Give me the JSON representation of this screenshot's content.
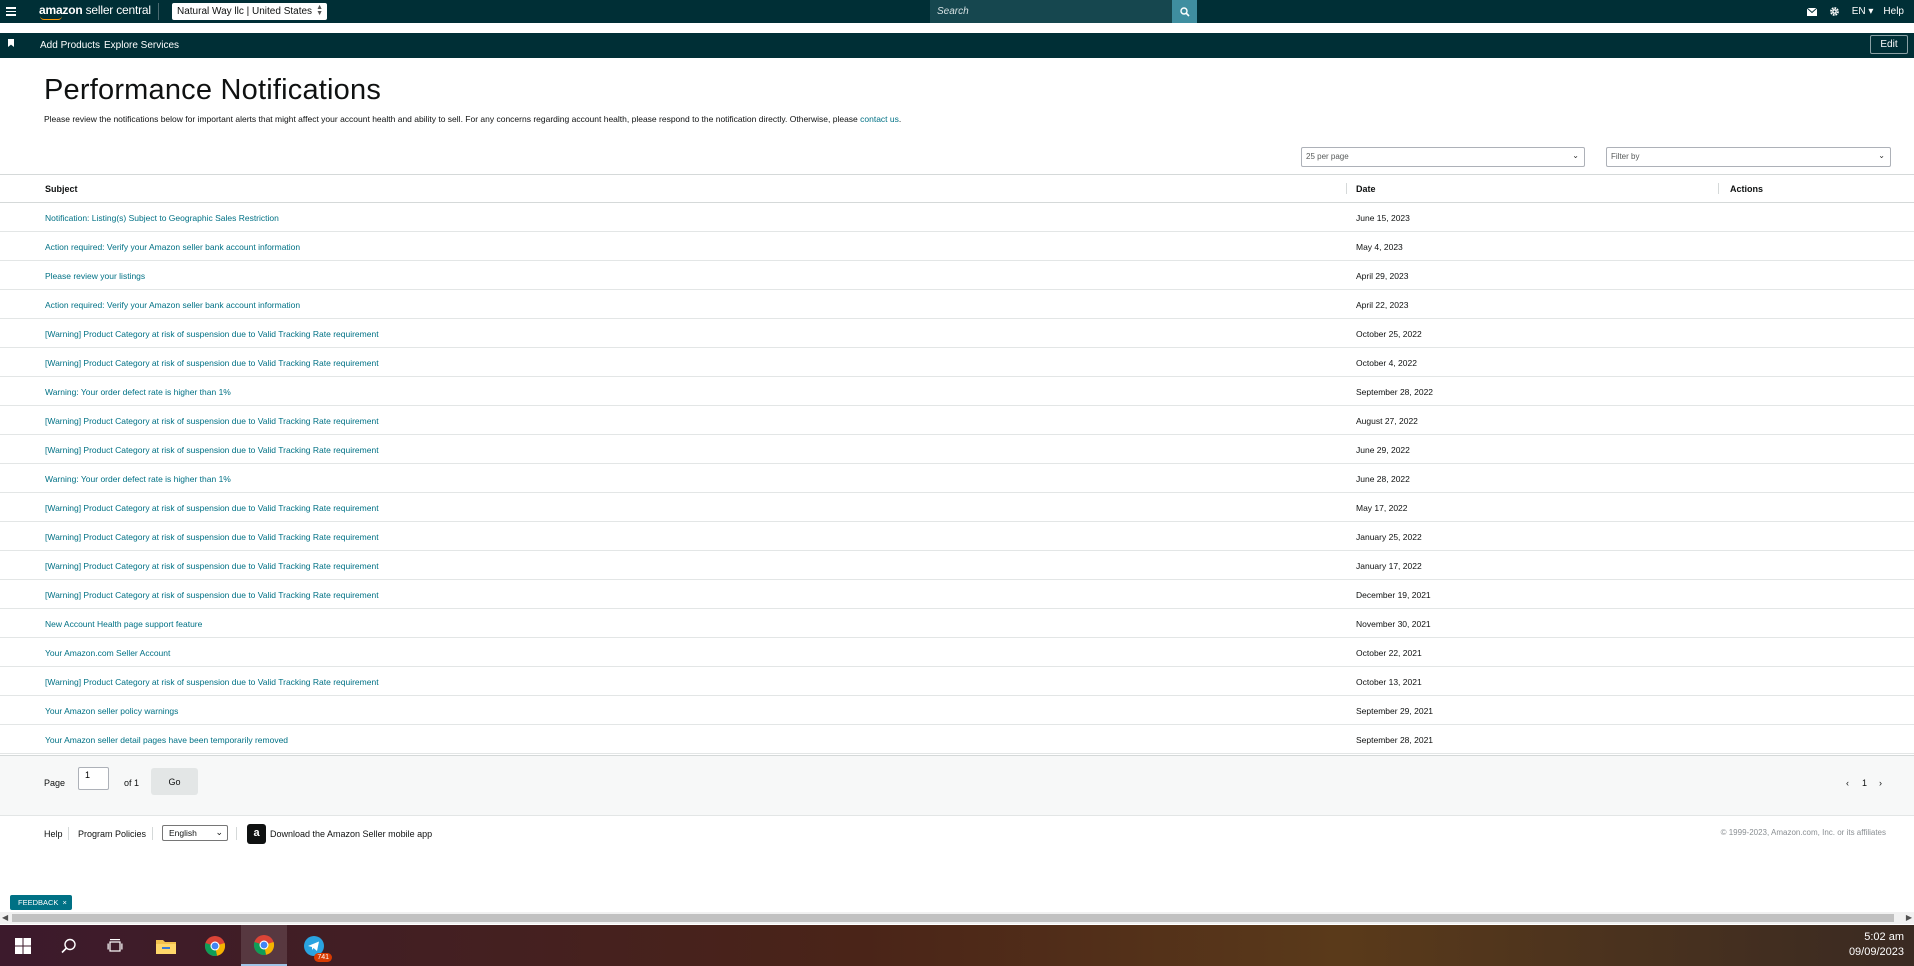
{
  "header": {
    "logo_brand": "amazon",
    "logo_suffix": "seller central",
    "store_selector": "Natural Way llc | United States",
    "search_placeholder": "Search",
    "language": "EN",
    "help": "Help"
  },
  "subnav": {
    "add_products": "Add Products",
    "explore_services": "Explore Services",
    "edit": "Edit"
  },
  "page": {
    "title": "Performance Notifications",
    "description": "Please review the notifications below for important alerts that might affect your account health and ability to sell. For any concerns regarding account health, please respond to the notification directly. Otherwise, please ",
    "contact_link": "contact us",
    "description_end": "."
  },
  "controls": {
    "per_page": "25 per page",
    "filter_placeholder": "Filter by"
  },
  "table": {
    "headers": {
      "subject": "Subject",
      "date": "Date",
      "actions": "Actions"
    },
    "rows": [
      {
        "subject": "Notification: Listing(s) Subject to Geographic Sales Restriction",
        "date": "June 15, 2023"
      },
      {
        "subject": "Action required: Verify your Amazon seller bank account information",
        "date": "May 4, 2023"
      },
      {
        "subject": "Please review your listings",
        "date": "April 29, 2023"
      },
      {
        "subject": "Action required: Verify your Amazon seller bank account information",
        "date": "April 22, 2023"
      },
      {
        "subject": "[Warning] Product Category at risk of suspension due to Valid Tracking Rate requirement",
        "date": "October 25, 2022"
      },
      {
        "subject": "[Warning] Product Category at risk of suspension due to Valid Tracking Rate requirement",
        "date": "October 4, 2022"
      },
      {
        "subject": "Warning: Your order defect rate is higher than 1%",
        "date": "September 28, 2022"
      },
      {
        "subject": "[Warning] Product Category at risk of suspension due to Valid Tracking Rate requirement",
        "date": "August 27, 2022"
      },
      {
        "subject": "[Warning] Product Category at risk of suspension due to Valid Tracking Rate requirement",
        "date": "June 29, 2022"
      },
      {
        "subject": "Warning: Your order defect rate is higher than 1%",
        "date": "June 28, 2022"
      },
      {
        "subject": "[Warning] Product Category at risk of suspension due to Valid Tracking Rate requirement",
        "date": "May 17, 2022"
      },
      {
        "subject": "[Warning] Product Category at risk of suspension due to Valid Tracking Rate requirement",
        "date": "January 25, 2022"
      },
      {
        "subject": "[Warning] Product Category at risk of suspension due to Valid Tracking Rate requirement",
        "date": "January 17, 2022"
      },
      {
        "subject": "[Warning] Product Category at risk of suspension due to Valid Tracking Rate requirement",
        "date": "December 19, 2021"
      },
      {
        "subject": "New Account Health page support feature",
        "date": "November 30, 2021"
      },
      {
        "subject": "Your Amazon.com Seller Account",
        "date": "October 22, 2021"
      },
      {
        "subject": "[Warning] Product Category at risk of suspension due to Valid Tracking Rate requirement",
        "date": "October 13, 2021"
      },
      {
        "subject": "Your Amazon seller policy warnings",
        "date": "September 29, 2021"
      },
      {
        "subject": "Your Amazon seller detail pages have been temporarily removed",
        "date": "September 28, 2021"
      }
    ]
  },
  "pagination": {
    "page_label": "Page",
    "page_value": "1",
    "of_label": "of 1",
    "go": "Go",
    "prev": "‹",
    "current": "1",
    "next": "›"
  },
  "footer": {
    "help": "Help",
    "program_policies": "Program Policies",
    "language": "English",
    "download_app": "Download the Amazon Seller mobile app",
    "copyright": "© 1999-2023, Amazon.com, Inc. or its affiliates"
  },
  "feedback": {
    "label": "FEEDBACK",
    "close": "×"
  },
  "taskbar": {
    "time": "5:02 am",
    "date": "09/09/2023",
    "telegram_badge": "741"
  },
  "colors": {
    "nav_bg": "#002f36",
    "link": "#007185",
    "search_button": "#3f8ea0"
  }
}
